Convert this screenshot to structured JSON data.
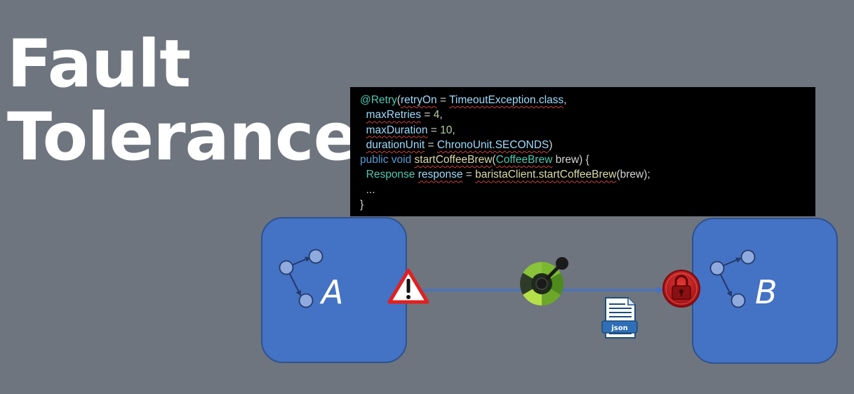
{
  "title": {
    "line1": "Fault",
    "line2": "Tolerance"
  },
  "code": {
    "l1": {
      "ann": "@Retry",
      "p1": "(",
      "key": "retryOn",
      "p2": " = ",
      "cls": "TimeoutException.class",
      "p3": ","
    },
    "l2": {
      "indent": "  ",
      "key": "maxRetries",
      "p2": " = ",
      "num": "4",
      "p3": ","
    },
    "l3": {
      "indent": "  ",
      "key": "maxDuration",
      "p2": " = ",
      "num": "10",
      "p3": ","
    },
    "l4": {
      "indent": "  ",
      "key": "durationUnit",
      "p2": " = ",
      "val": "ChronoUnit.SECONDS",
      "p3": ")"
    },
    "l5": {
      "kw": "public void ",
      "fn": "startCoffeeBrew",
      "p1": "(",
      "ty": "CoffeeBrew",
      "rest": " brew) {"
    },
    "l6": {
      "indent": "  ",
      "ty": "Response",
      "sp": " ",
      "var": "response",
      "p2": " = ",
      "call": "baristaClient.startCoffeeBrew",
      "rest": "(brew);"
    },
    "l7": {
      "text": "  ..."
    },
    "l8": {
      "text": "}"
    }
  },
  "services": {
    "a": {
      "label": "A"
    },
    "b": {
      "label": "B"
    }
  },
  "file_icon": {
    "label": "json"
  },
  "icons": [
    "warning-icon",
    "circuit-breaker-icon",
    "lock-icon",
    "json-file-icon",
    "service-graph-icon"
  ],
  "colors": {
    "background": "#6e757e",
    "service_box": "#4472c4",
    "arrow": "#4472c4",
    "warning_red": "#e02020",
    "lock_red": "#c0161b"
  }
}
